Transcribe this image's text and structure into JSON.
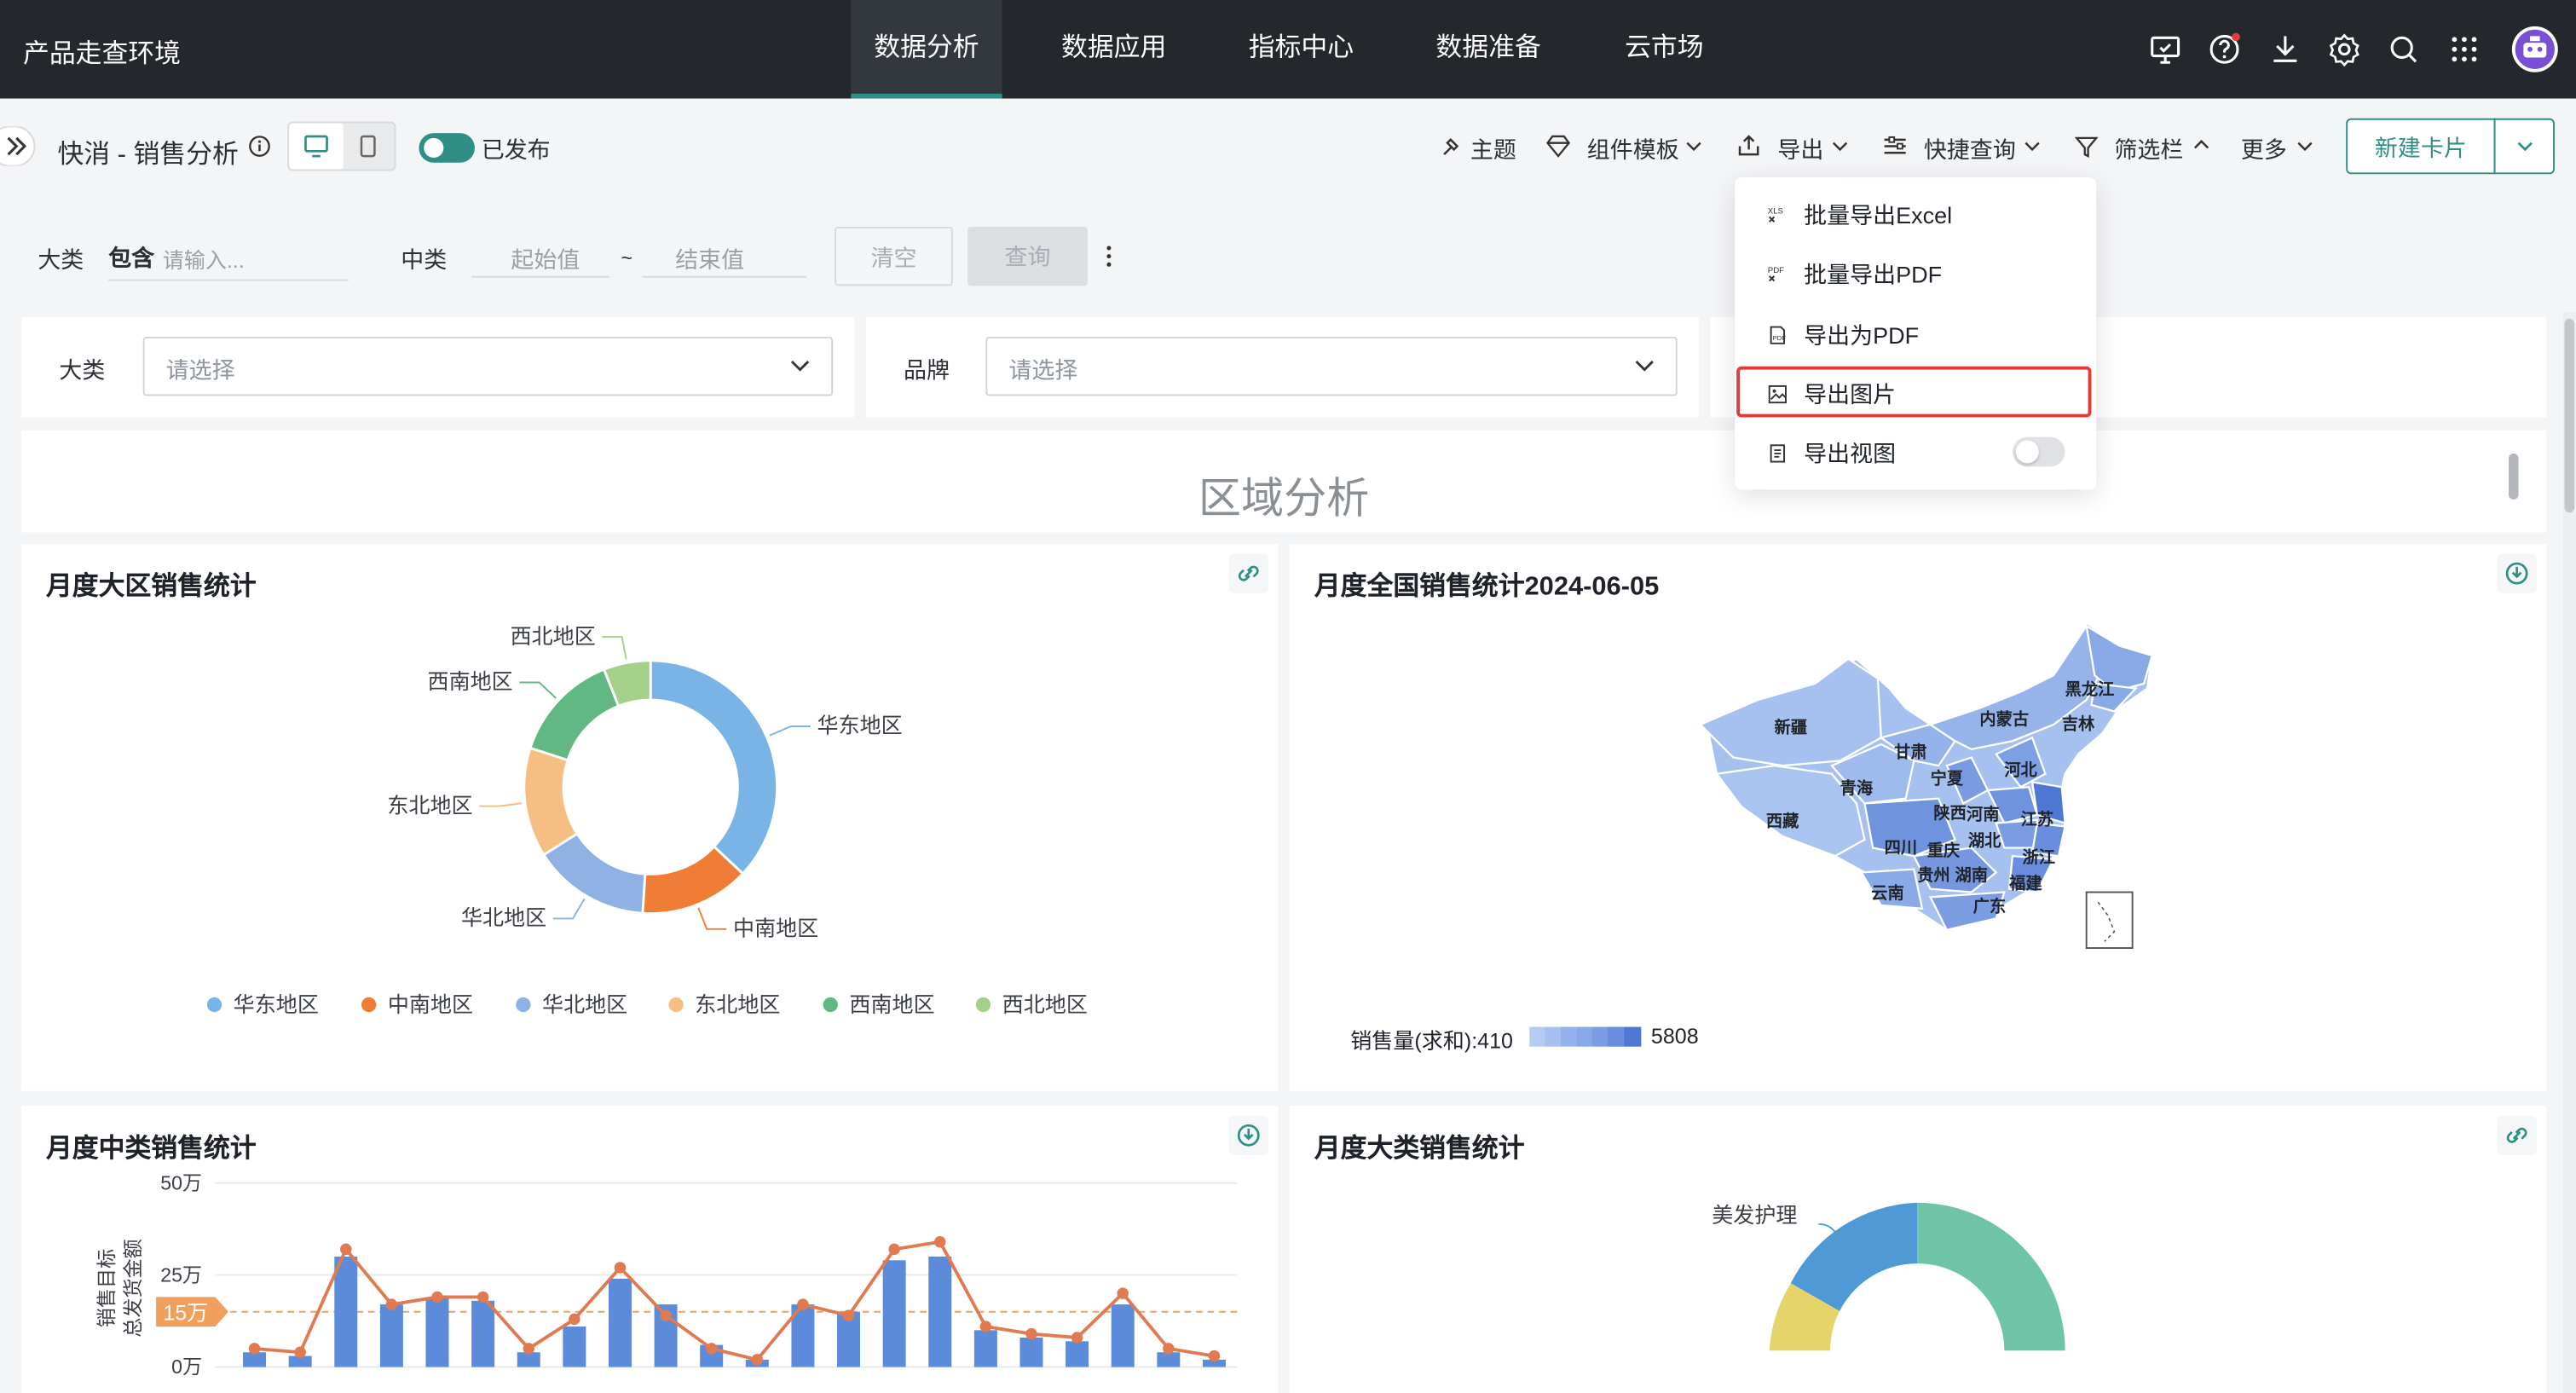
{
  "app": {
    "brand": "产品走查环境",
    "nav_tabs": [
      "数据分析",
      "数据应用",
      "指标中心",
      "数据准备",
      "云市场"
    ],
    "active_tab": "数据分析"
  },
  "toolbar": {
    "page_title": "快消 - 销售分析",
    "status_label": "已发布",
    "theme_label": "主题",
    "component_template_label": "组件模板",
    "export_label": "导出",
    "quick_query_label": "快捷查询",
    "filter_bar_label": "筛选栏",
    "more_label": "更多",
    "new_card_label": "新建卡片"
  },
  "export_menu": {
    "items": [
      {
        "label": "批量导出Excel",
        "icon": "xls-icon"
      },
      {
        "label": "批量导出PDF",
        "icon": "pdf-icon"
      },
      {
        "label": "导出为PDF",
        "icon": "pdf-file-icon"
      },
      {
        "label": "导出图片",
        "icon": "image-icon",
        "highlighted": true
      },
      {
        "label": "导出视图",
        "icon": "view-icon",
        "toggle": false
      }
    ],
    "highlight_color": "#e03c3c"
  },
  "filters": {
    "category_label": "大类",
    "category_mode": "包含",
    "category_placeholder": "请输入...",
    "mid_label": "中类",
    "range_start_placeholder": "起始值",
    "range_sep": "~",
    "range_end_placeholder": "结束值",
    "clear_label": "清空",
    "query_label": "查询"
  },
  "selectors": [
    {
      "label": "大类",
      "placeholder": "请选择"
    },
    {
      "label": "品牌",
      "placeholder": "请选择"
    }
  ],
  "section_title": "区域分析",
  "cards": {
    "region_title": "月度大区销售统计",
    "map_title": "月度全国销售统计2024-06-05",
    "mid_title": "月度中类销售统计",
    "big_title": "月度大类销售统计"
  },
  "map": {
    "legend_label": "销售量(求和):410",
    "legend_max": "5808",
    "provinces": [
      "新疆",
      "西藏",
      "青海",
      "甘肃",
      "内蒙古",
      "黑龙江",
      "吉林",
      "河北",
      "宁夏",
      "陕西",
      "河南",
      "江苏",
      "四川",
      "重庆",
      "湖北",
      "浙江",
      "贵州",
      "湖南",
      "福建",
      "云南",
      "广东"
    ]
  },
  "chart_data": [
    {
      "type": "pie",
      "title": "月度大区销售统计",
      "donut": true,
      "categories": [
        "华东地区",
        "中南地区",
        "华北地区",
        "东北地区",
        "西南地区",
        "西北地区"
      ],
      "values": [
        37,
        14,
        15,
        14,
        14,
        6
      ],
      "colors": [
        "#7ab4e6",
        "#ef7d35",
        "#8fb1e3",
        "#f5bf83",
        "#62b883",
        "#a5d08a"
      ],
      "legend": "bottom"
    },
    {
      "type": "bar",
      "title": "月度中类销售统计",
      "ylabel": "销售目标",
      "ylabel2": "总发货金额",
      "yticks": [
        "0万",
        "25万",
        "50万"
      ],
      "ylim": [
        0,
        50
      ],
      "reference_label": "15万",
      "reference_value": 15,
      "bar_values": [
        4,
        3,
        30,
        17,
        19,
        18,
        4,
        11,
        24,
        17,
        6,
        2,
        17,
        15,
        29,
        30,
        10,
        8,
        7,
        17,
        4,
        2
      ],
      "line_values": [
        5,
        4,
        32,
        17,
        19,
        19,
        5,
        13,
        27,
        14,
        5,
        2,
        17,
        14,
        32,
        34,
        11,
        9,
        8,
        20,
        5,
        3
      ],
      "colors": {
        "bar": "#5b8bd9",
        "line": "#e07a50",
        "reference": "#f0a05c"
      }
    },
    {
      "type": "pie",
      "title": "月度大类销售统计",
      "donut": true,
      "categories": [
        "美发护理"
      ],
      "colors": [
        "#6fc4a8",
        "#e4d46a",
        "#4f9ad4"
      ]
    }
  ]
}
